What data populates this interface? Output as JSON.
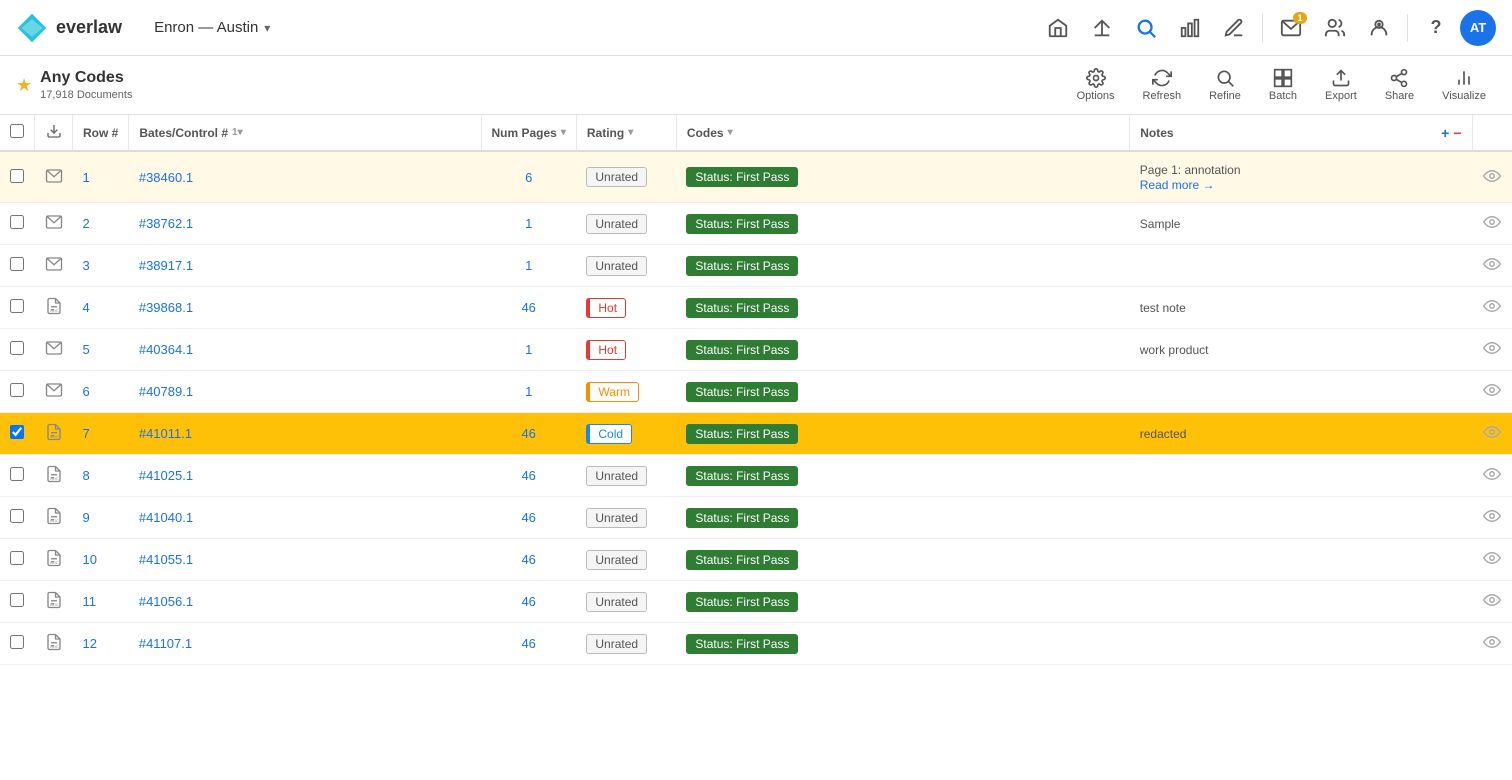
{
  "app": {
    "logo_text": "everlaw",
    "project": "Enron — Austin",
    "project_chevron": "▾"
  },
  "nav": {
    "icons": [
      {
        "name": "home-icon",
        "symbol": "⌂",
        "active": false
      },
      {
        "name": "upload-icon",
        "symbol": "⇅",
        "active": false
      },
      {
        "name": "search-icon",
        "symbol": "🔍",
        "active": true
      },
      {
        "name": "chart-icon",
        "symbol": "📊",
        "active": false
      },
      {
        "name": "edit-icon",
        "symbol": "✏",
        "active": false
      }
    ],
    "mail_badge": "1",
    "people_icon": "👤",
    "question_icon": "?",
    "avatar_text": "AT"
  },
  "toolbar": {
    "title": "Any Codes",
    "doc_count": "17,918 Documents",
    "buttons": [
      {
        "name": "options-button",
        "label": "Options",
        "icon": "⚙"
      },
      {
        "name": "refresh-button",
        "label": "Refresh",
        "icon": "↻"
      },
      {
        "name": "refine-button",
        "label": "Refine",
        "icon": "🔍"
      },
      {
        "name": "batch-button",
        "label": "Batch",
        "icon": "⊞"
      },
      {
        "name": "export-button",
        "label": "Export",
        "icon": "↗"
      },
      {
        "name": "share-button",
        "label": "Share",
        "icon": "⇧"
      },
      {
        "name": "visualize-button",
        "label": "Visualize",
        "icon": "📈"
      }
    ]
  },
  "table": {
    "columns": [
      {
        "name": "checkbox-col",
        "label": ""
      },
      {
        "name": "download-col",
        "label": "⬇"
      },
      {
        "name": "row-col",
        "label": "Row #"
      },
      {
        "name": "bates-col",
        "label": "Bates/Control #",
        "sort": "1▾"
      },
      {
        "name": "numpages-col",
        "label": "Num Pages",
        "filter": "▾"
      },
      {
        "name": "rating-col",
        "label": "Rating",
        "filter": "▾"
      },
      {
        "name": "codes-col",
        "label": "Codes",
        "filter": "▾"
      },
      {
        "name": "notes-col",
        "label": "Notes"
      }
    ],
    "rows": [
      {
        "id": 1,
        "row_num": "1",
        "bates": "#38460.1",
        "num_pages": "6",
        "rating": "Unrated",
        "rating_type": "unrated",
        "code": "Status: First Pass",
        "note": "Page 1: annotation",
        "note_link": "Read more →",
        "doc_type": "email",
        "highlight": true,
        "selected": false
      },
      {
        "id": 2,
        "row_num": "2",
        "bates": "#38762.1",
        "num_pages": "1",
        "rating": "Unrated",
        "rating_type": "unrated",
        "code": "Status: First Pass",
        "note": "Sample",
        "note_link": "",
        "doc_type": "email",
        "highlight": false,
        "selected": false
      },
      {
        "id": 3,
        "row_num": "3",
        "bates": "#38917.1",
        "num_pages": "1",
        "rating": "Unrated",
        "rating_type": "unrated",
        "code": "Status: First Pass",
        "note": "",
        "note_link": "",
        "doc_type": "email",
        "highlight": false,
        "selected": false
      },
      {
        "id": 4,
        "row_num": "4",
        "bates": "#39868.1",
        "num_pages": "46",
        "rating": "Hot",
        "rating_type": "hot",
        "code": "Status: First Pass",
        "note": "test note",
        "note_link": "",
        "doc_type": "doc",
        "highlight": false,
        "selected": false
      },
      {
        "id": 5,
        "row_num": "5",
        "bates": "#40364.1",
        "num_pages": "1",
        "rating": "Hot",
        "rating_type": "hot",
        "code": "Status: First Pass",
        "note": "work product",
        "note_link": "",
        "doc_type": "email",
        "highlight": false,
        "selected": false
      },
      {
        "id": 6,
        "row_num": "6",
        "bates": "#40789.1",
        "num_pages": "1",
        "rating": "Warm",
        "rating_type": "warm",
        "code": "Status: First Pass",
        "note": "",
        "note_link": "",
        "doc_type": "email",
        "highlight": false,
        "selected": false
      },
      {
        "id": 7,
        "row_num": "7",
        "bates": "#41011.1",
        "num_pages": "46",
        "rating": "Cold",
        "rating_type": "cold",
        "code": "Status: First Pass",
        "note": "redacted",
        "note_link": "",
        "doc_type": "doc",
        "highlight": false,
        "selected": true
      },
      {
        "id": 8,
        "row_num": "8",
        "bates": "#41025.1",
        "num_pages": "46",
        "rating": "Unrated",
        "rating_type": "unrated",
        "code": "Status: First Pass",
        "note": "",
        "note_link": "",
        "doc_type": "doc",
        "highlight": false,
        "selected": false
      },
      {
        "id": 9,
        "row_num": "9",
        "bates": "#41040.1",
        "num_pages": "46",
        "rating": "Unrated",
        "rating_type": "unrated",
        "code": "Status: First Pass",
        "note": "",
        "note_link": "",
        "doc_type": "doc",
        "highlight": false,
        "selected": false
      },
      {
        "id": 10,
        "row_num": "10",
        "bates": "#41055.1",
        "num_pages": "46",
        "rating": "Unrated",
        "rating_type": "unrated",
        "code": "Status: First Pass",
        "note": "",
        "note_link": "",
        "doc_type": "doc",
        "highlight": false,
        "selected": false
      },
      {
        "id": 11,
        "row_num": "11",
        "bates": "#41056.1",
        "num_pages": "46",
        "rating": "Unrated",
        "rating_type": "unrated",
        "code": "Status: First Pass",
        "note": "",
        "note_link": "",
        "doc_type": "doc",
        "highlight": false,
        "selected": false
      },
      {
        "id": 12,
        "row_num": "12",
        "bates": "#41107.1",
        "num_pages": "46",
        "rating": "Unrated",
        "rating_type": "unrated",
        "code": "Status: First Pass",
        "note": "",
        "note_link": "",
        "doc_type": "doc",
        "highlight": false,
        "selected": false
      }
    ]
  },
  "colors": {
    "accent": "#1a73e8",
    "selected_row": "#ffc107",
    "highlight_row": "#fff9e6",
    "hot": "#e53935",
    "warm": "#fb8c00",
    "cold": "#1e88e5",
    "code_green": "#2e7d32"
  }
}
